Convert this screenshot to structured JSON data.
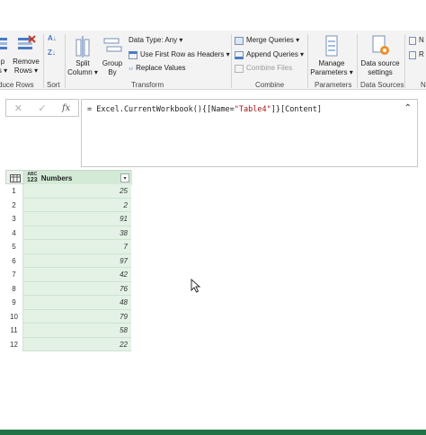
{
  "ribbon": {
    "groups": {
      "reduce_rows": "duce Rows",
      "sort": "Sort",
      "transform": "Transform",
      "combine": "Combine",
      "parameters": "Parameters",
      "data_sources": "Data Sources",
      "cut_last": "N"
    },
    "keep_rows_partial": {
      "line1": "p",
      "line2": "s ▾"
    },
    "remove_rows": {
      "line1": "Remove",
      "line2": "Rows ▾"
    },
    "split_column": {
      "line1": "Split",
      "line2": "Column ▾"
    },
    "group_by": {
      "line1": "Group",
      "line2": "By"
    },
    "data_type": "Data Type: Any ▾",
    "first_row_headers": "Use First Row as Headers ▾",
    "replace_values": "Replace Values",
    "merge_queries": "Merge Queries ▾",
    "append_queries": "Append Queries ▾",
    "combine_files": "Combine Files",
    "manage_parameters": {
      "line1": "Manage",
      "line2": "Parameters ▾"
    },
    "data_source_settings": {
      "line1": "Data source",
      "line2": "settings"
    },
    "cut_right_1": "N",
    "cut_right_2": "R"
  },
  "formula_bar": {
    "cancel_glyph": "✕",
    "confirm_glyph": "✓",
    "fx_glyph": "fx",
    "formula_prefix": "= Excel.CurrentWorkbook(){[Name=",
    "formula_string": "\"Table4\"",
    "formula_suffix": "]}[Content]",
    "expand_glyph": "⌃"
  },
  "grid": {
    "type_icon_top": "ABC",
    "type_icon_bottom": "123",
    "column_name": "Numbers",
    "dropdown_glyph": "▾",
    "rows": [
      {
        "n": "1",
        "v": "25"
      },
      {
        "n": "2",
        "v": "2"
      },
      {
        "n": "3",
        "v": "91"
      },
      {
        "n": "4",
        "v": "38"
      },
      {
        "n": "5",
        "v": "7"
      },
      {
        "n": "6",
        "v": "97"
      },
      {
        "n": "7",
        "v": "42"
      },
      {
        "n": "8",
        "v": "76"
      },
      {
        "n": "9",
        "v": "48"
      },
      {
        "n": "10",
        "v": "79"
      },
      {
        "n": "11",
        "v": "58"
      },
      {
        "n": "12",
        "v": "22"
      }
    ]
  },
  "colors": {
    "accent_green": "#217346",
    "column_header": "#d3ead7",
    "cell_fill": "#e3f2e5",
    "ribbon_bg": "#f3f3f3"
  }
}
